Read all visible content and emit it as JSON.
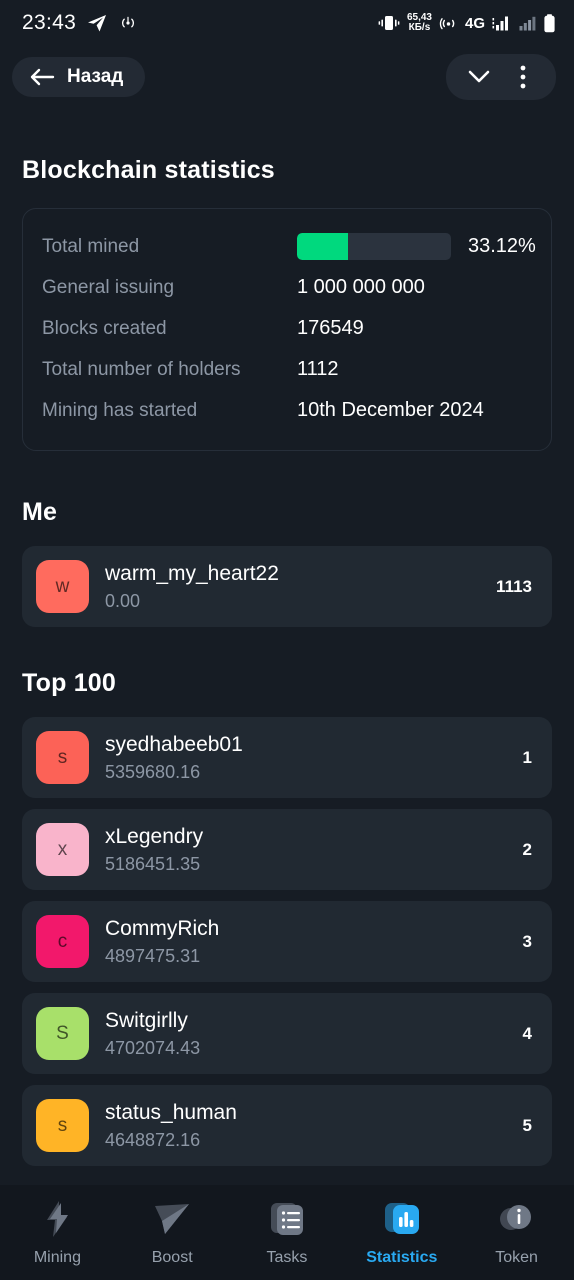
{
  "statusbar": {
    "time": "23:43",
    "net_speed_value": "65,43",
    "net_speed_unit": "КБ/s",
    "network_type": "4G",
    "icons": [
      "telegram-icon",
      "broadcast-icon",
      "vibrate-icon",
      "hotspot-icon",
      "signal-icon",
      "signal-icon-2",
      "battery-icon"
    ]
  },
  "header": {
    "back_label": "Назад",
    "collapse_icon": "chevron-down-icon",
    "menu_icon": "more-vertical-icon"
  },
  "blockchain": {
    "title": "Blockchain statistics",
    "rows": [
      {
        "label": "Total mined",
        "value": "33.12%",
        "type": "progress",
        "percent": 33.12
      },
      {
        "label": "General issuing",
        "value": "1 000 000 000",
        "type": "text"
      },
      {
        "label": "Blocks created",
        "value": "176549",
        "type": "text"
      },
      {
        "label": "Total number of holders",
        "value": "1112",
        "type": "text"
      },
      {
        "label": "Mining has started",
        "value": "10th December 2024",
        "type": "text"
      }
    ],
    "progress_color": "#00d97e",
    "track_color": "#2b333e"
  },
  "me": {
    "title": "Me",
    "entry": {
      "initial": "w",
      "name": "warm_my_heart22",
      "balance": "0.00",
      "rank": "1113",
      "avatar_color": "#ff6b5e"
    }
  },
  "top": {
    "title": "Top 100",
    "entries": [
      {
        "initial": "s",
        "name": "syedhabeeb01",
        "balance": "5359680.16",
        "rank": "1",
        "avatar_color": "#fc6257"
      },
      {
        "initial": "x",
        "name": "xLegendry",
        "balance": "5186451.35",
        "rank": "2",
        "avatar_color": "#f9b4cb"
      },
      {
        "initial": "c",
        "name": "CommyRich",
        "balance": "4897475.31",
        "rank": "3",
        "avatar_color": "#f2186b"
      },
      {
        "initial": "S",
        "name": "Switgirlly",
        "balance": "4702074.43",
        "rank": "4",
        "avatar_color": "#a8e06a"
      },
      {
        "initial": "s",
        "name": "status_human",
        "balance": "4648872.16",
        "rank": "5",
        "avatar_color": "#ffb426"
      }
    ]
  },
  "bottomnav": {
    "active": "Statistics",
    "accent": "#29a9f1",
    "items": [
      {
        "label": "Mining",
        "icon": "lightning-icon"
      },
      {
        "label": "Boost",
        "icon": "paper-plane-icon"
      },
      {
        "label": "Tasks",
        "icon": "checklist-icon"
      },
      {
        "label": "Statistics",
        "icon": "bar-chart-icon"
      },
      {
        "label": "Token",
        "icon": "info-circle-icon"
      }
    ]
  }
}
